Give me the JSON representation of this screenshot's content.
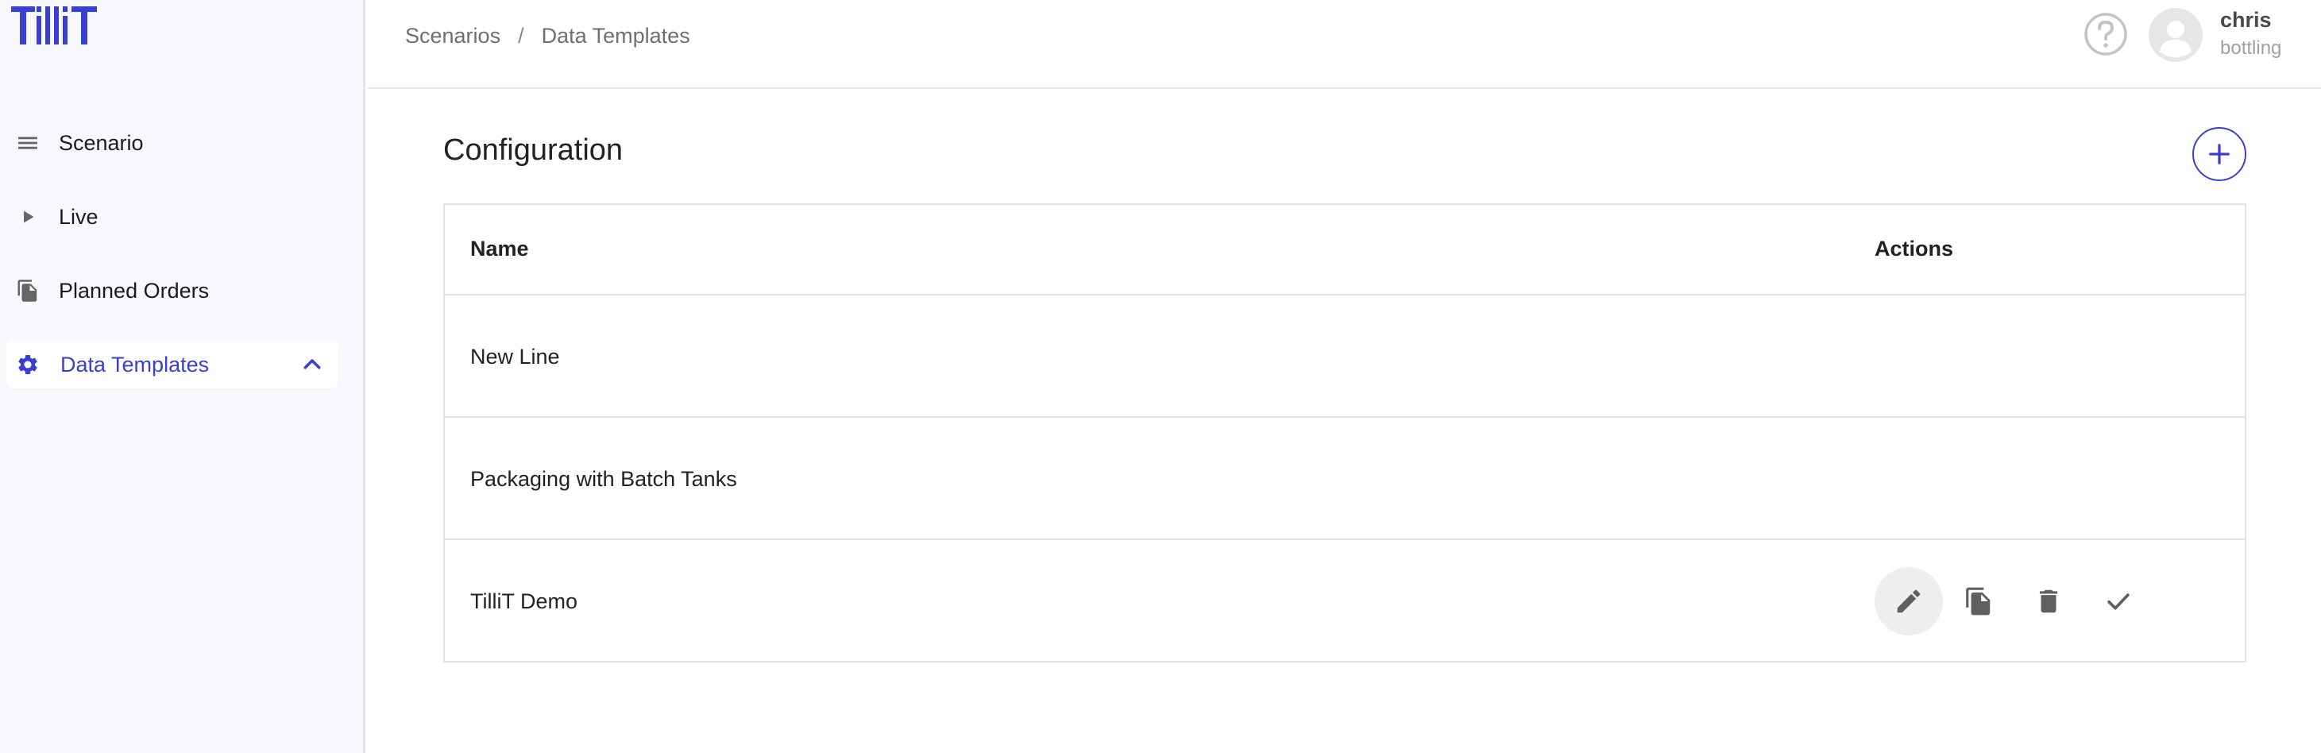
{
  "brand": {
    "logo_text": "TilliT",
    "accent": "#3a3fcf"
  },
  "sidebar": {
    "items": [
      {
        "label": "Scenario",
        "icon": "list-icon",
        "active": false
      },
      {
        "label": "Live",
        "icon": "play-icon",
        "active": false
      },
      {
        "label": "Planned Orders",
        "icon": "documents-icon",
        "active": false
      },
      {
        "label": "Data Templates",
        "icon": "gear-icon",
        "active": true,
        "expanded": true
      }
    ]
  },
  "header": {
    "breadcrumb": [
      "Scenarios",
      "Data Templates"
    ],
    "breadcrumb_separator": "/",
    "user": {
      "name": "chris",
      "org": "bottling"
    }
  },
  "main": {
    "title": "Configuration",
    "table": {
      "columns": [
        "Name",
        "Actions"
      ],
      "rows": [
        {
          "name": "New Line"
        },
        {
          "name": "Packaging with Batch Tanks"
        },
        {
          "name": "TilliT Demo",
          "actions": [
            "edit-icon",
            "copy-icon",
            "delete-icon",
            "check-icon"
          ]
        }
      ]
    }
  }
}
